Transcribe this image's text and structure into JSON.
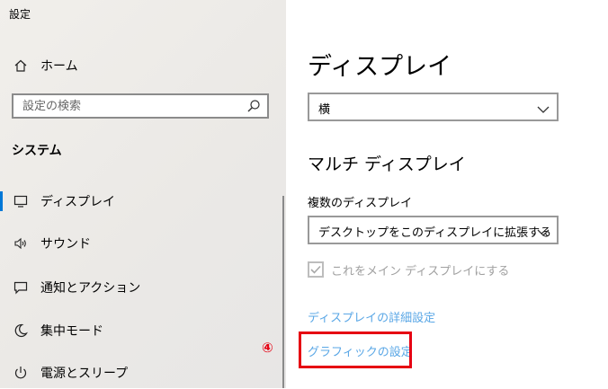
{
  "window": {
    "title": "設定"
  },
  "sidebar": {
    "home_label": "ホーム",
    "search_placeholder": "設定の検索",
    "section_title": "システム",
    "items": [
      {
        "label": "ディスプレイ",
        "icon": "monitor-icon"
      },
      {
        "label": "サウンド",
        "icon": "speaker-icon"
      },
      {
        "label": "通知とアクション",
        "icon": "notification-icon"
      },
      {
        "label": "集中モード",
        "icon": "moon-icon"
      },
      {
        "label": "電源とスリープ",
        "icon": "power-icon"
      }
    ],
    "annotation_badge": "④"
  },
  "main": {
    "title": "ディスプレイ",
    "orientation_value": "横",
    "multi_display": {
      "heading": "マルチ ディスプレイ",
      "label": "複数のディスプレイ",
      "selected": "デスクトップをこのディスプレイに拡張する",
      "checkbox_label": "これをメイン ディスプレイにする"
    },
    "links": {
      "advanced": "ディスプレイの詳細設定",
      "graphics": "グラフィックの設定"
    }
  },
  "colors": {
    "accent": "#0078d7",
    "link": "#5aa7e6",
    "highlight": "#e60012"
  }
}
